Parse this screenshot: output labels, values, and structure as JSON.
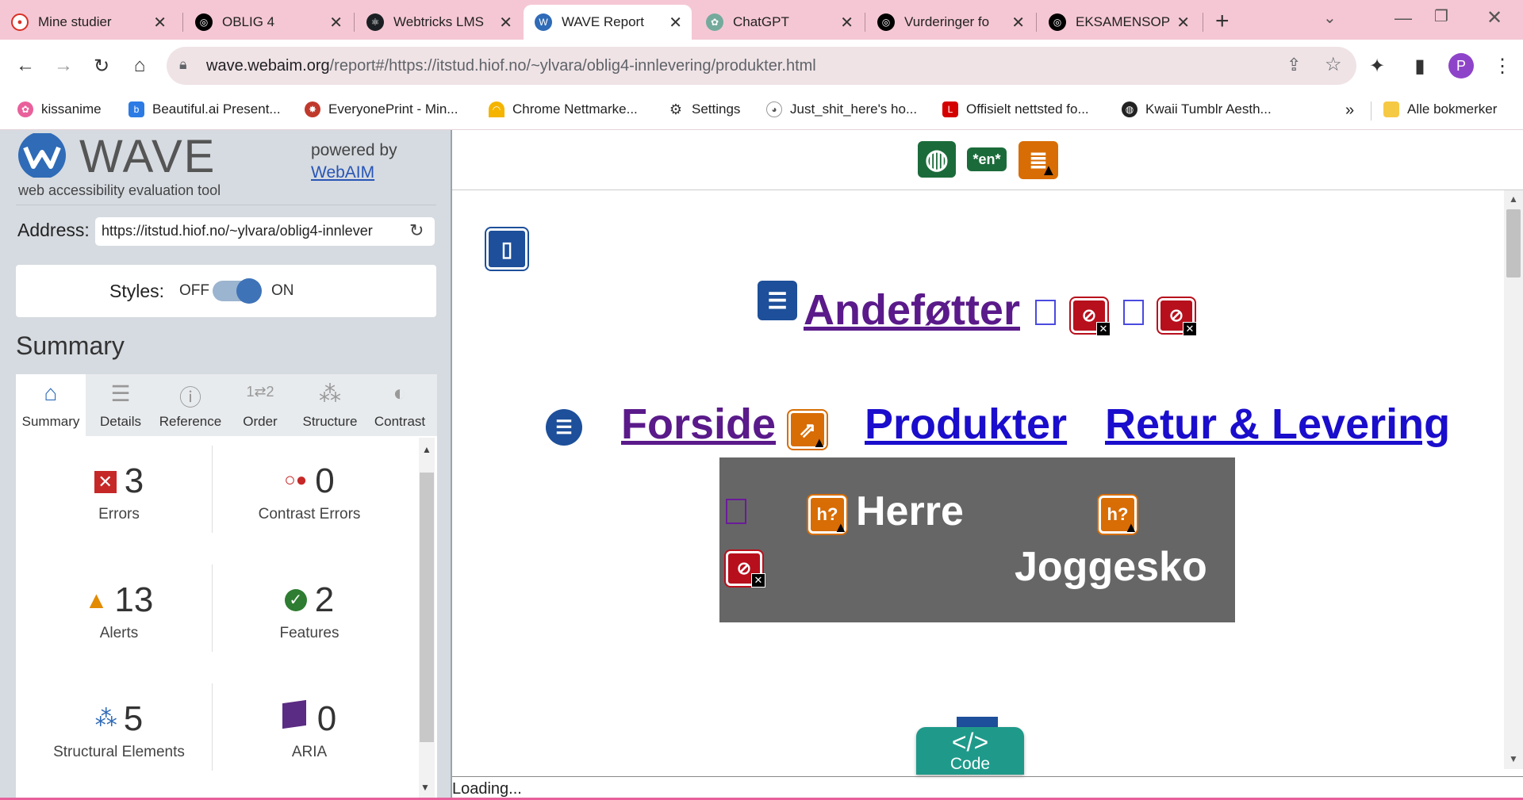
{
  "tabs": [
    {
      "title": "Mine studier",
      "icon": "reddit-icon",
      "color": "#d93025"
    },
    {
      "title": "OBLIG 4",
      "icon": "app-icon",
      "color": "#000000"
    },
    {
      "title": "Webtricks LMS",
      "icon": "react-icon",
      "color": "#1b1f23"
    },
    {
      "title": "WAVE Report",
      "icon": "wave-icon",
      "color": "#2f6bb7"
    },
    {
      "title": "ChatGPT",
      "icon": "chatgpt-icon",
      "color": "#74aa9c"
    },
    {
      "title": "Vurderinger fo",
      "icon": "app-icon",
      "color": "#000000"
    },
    {
      "title": "EKSAMENSOPP",
      "icon": "app-icon",
      "color": "#000000"
    }
  ],
  "address": {
    "domain": "wave.webaim.org",
    "path": "/report#/https://itstud.hiof.no/~ylvara/oblig4-innlevering/produkter.html"
  },
  "profile_initial": "P",
  "bookmarks": [
    {
      "label": "kissanime",
      "icon": "flower-icon"
    },
    {
      "label": "Beautiful.ai Present...",
      "icon": "beautiful-ai-icon"
    },
    {
      "label": "EveryonePrint - Min...",
      "icon": "print-icon"
    },
    {
      "label": "Chrome Nettmarke...",
      "icon": "rainbow-icon"
    },
    {
      "label": "Settings",
      "icon": "gear-icon"
    },
    {
      "label": "Just_shit_here's ho...",
      "icon": "reddit-icon"
    },
    {
      "label": "Offisielt nettsted fo...",
      "icon": "l-icon"
    },
    {
      "label": "Kwaii Tumblr Aesth...",
      "icon": "globe-icon"
    }
  ],
  "bookmarks_overflow": "»",
  "all_bookmarks": "Alle bokmerker",
  "wave": {
    "logo_text": "WAVE",
    "tagline": "web accessibility evaluation tool",
    "powered_by": "powered by",
    "webaim_link": "WebAIM",
    "address_label": "Address:",
    "address_value": "https://itstud.hiof.no/~ylvara/oblig4-innlever",
    "styles_label": "Styles:",
    "styles_off": "OFF",
    "styles_on": "ON",
    "summary_heading": "Summary",
    "tabs": [
      {
        "label": "Summary",
        "icon": "home-icon"
      },
      {
        "label": "Details",
        "icon": "list-icon"
      },
      {
        "label": "Reference",
        "icon": "info-icon"
      },
      {
        "label": "Order",
        "icon": "order-icon"
      },
      {
        "label": "Structure",
        "icon": "structure-icon"
      },
      {
        "label": "Contrast",
        "icon": "contrast-icon"
      }
    ],
    "stats": {
      "errors": {
        "value": "3",
        "label": "Errors"
      },
      "contrast": {
        "value": "0",
        "label": "Contrast Errors"
      },
      "alerts": {
        "value": "13",
        "label": "Alerts"
      },
      "features": {
        "value": "2",
        "label": "Features"
      },
      "structure": {
        "value": "5",
        "label": "Structural Elements"
      },
      "aria": {
        "value": "0",
        "label": "ARIA"
      }
    }
  },
  "page": {
    "lang_badge": "*en*",
    "site_title": "Andeføtter",
    "nav": [
      "Forside",
      "Produkter",
      "Retur & Levering"
    ],
    "product_box": {
      "heading1": "Herre",
      "heading2": "Joggesko"
    },
    "code_button": "Code",
    "code_glyph": "</>",
    "status": "Loading..."
  },
  "colors": {
    "tabbar": "#f5c7d4",
    "visited_link": "#5a1a8a",
    "link": "#1a0dcc",
    "error_red": "#b80f1c",
    "alert_orange": "#d86d05",
    "structure_blue": "#1d4f9a",
    "code_teal": "#1f9a8a"
  }
}
